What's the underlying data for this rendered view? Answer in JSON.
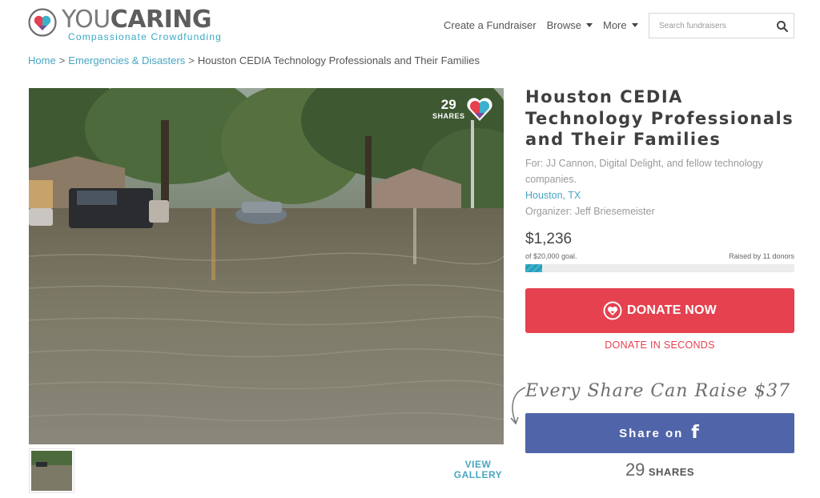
{
  "brand": {
    "name_part1": "YOU",
    "name_part2": "CARING",
    "tagline": "Compassionate Crowdfunding",
    "colors": {
      "accent": "#49a6c2",
      "donate": "#e5414f",
      "facebook": "#5065a9"
    }
  },
  "nav": {
    "create_label": "Create a Fundraiser",
    "browse_label": "Browse",
    "more_label": "More",
    "search_placeholder": "Search fundraisers",
    "search_icon": "search-icon"
  },
  "breadcrumb": {
    "home": "Home",
    "separator": ">",
    "category": "Emergencies & Disasters",
    "current": "Houston CEDIA Technology Professionals and Their Families"
  },
  "photo": {
    "shares_count": "29",
    "shares_label": "SHARES",
    "view_gallery_line1": "VIEW",
    "view_gallery_line2": "GALLERY"
  },
  "campaign": {
    "title": "Houston CEDIA Technology Professionals and Their Families",
    "for_text": "For: JJ Cannon, Digital Delight, and fellow technology companies.",
    "location": "Houston, TX",
    "organizer": "Organizer: Jeff Briesemeister",
    "raised": "$1,236",
    "goal_text": "of $20,000 goal.",
    "donors_text": "Raised by 11 donors",
    "progress_fraction": 0.062
  },
  "actions": {
    "donate_label": "DONATE NOW",
    "donate_subtext": "DONATE IN SECONDS",
    "share_tagline": "Every Share Can Raise $37",
    "fb_share_label": "Share on",
    "fb_icon_glyph": "f",
    "shares_number": "29",
    "shares_word": "SHARES"
  }
}
